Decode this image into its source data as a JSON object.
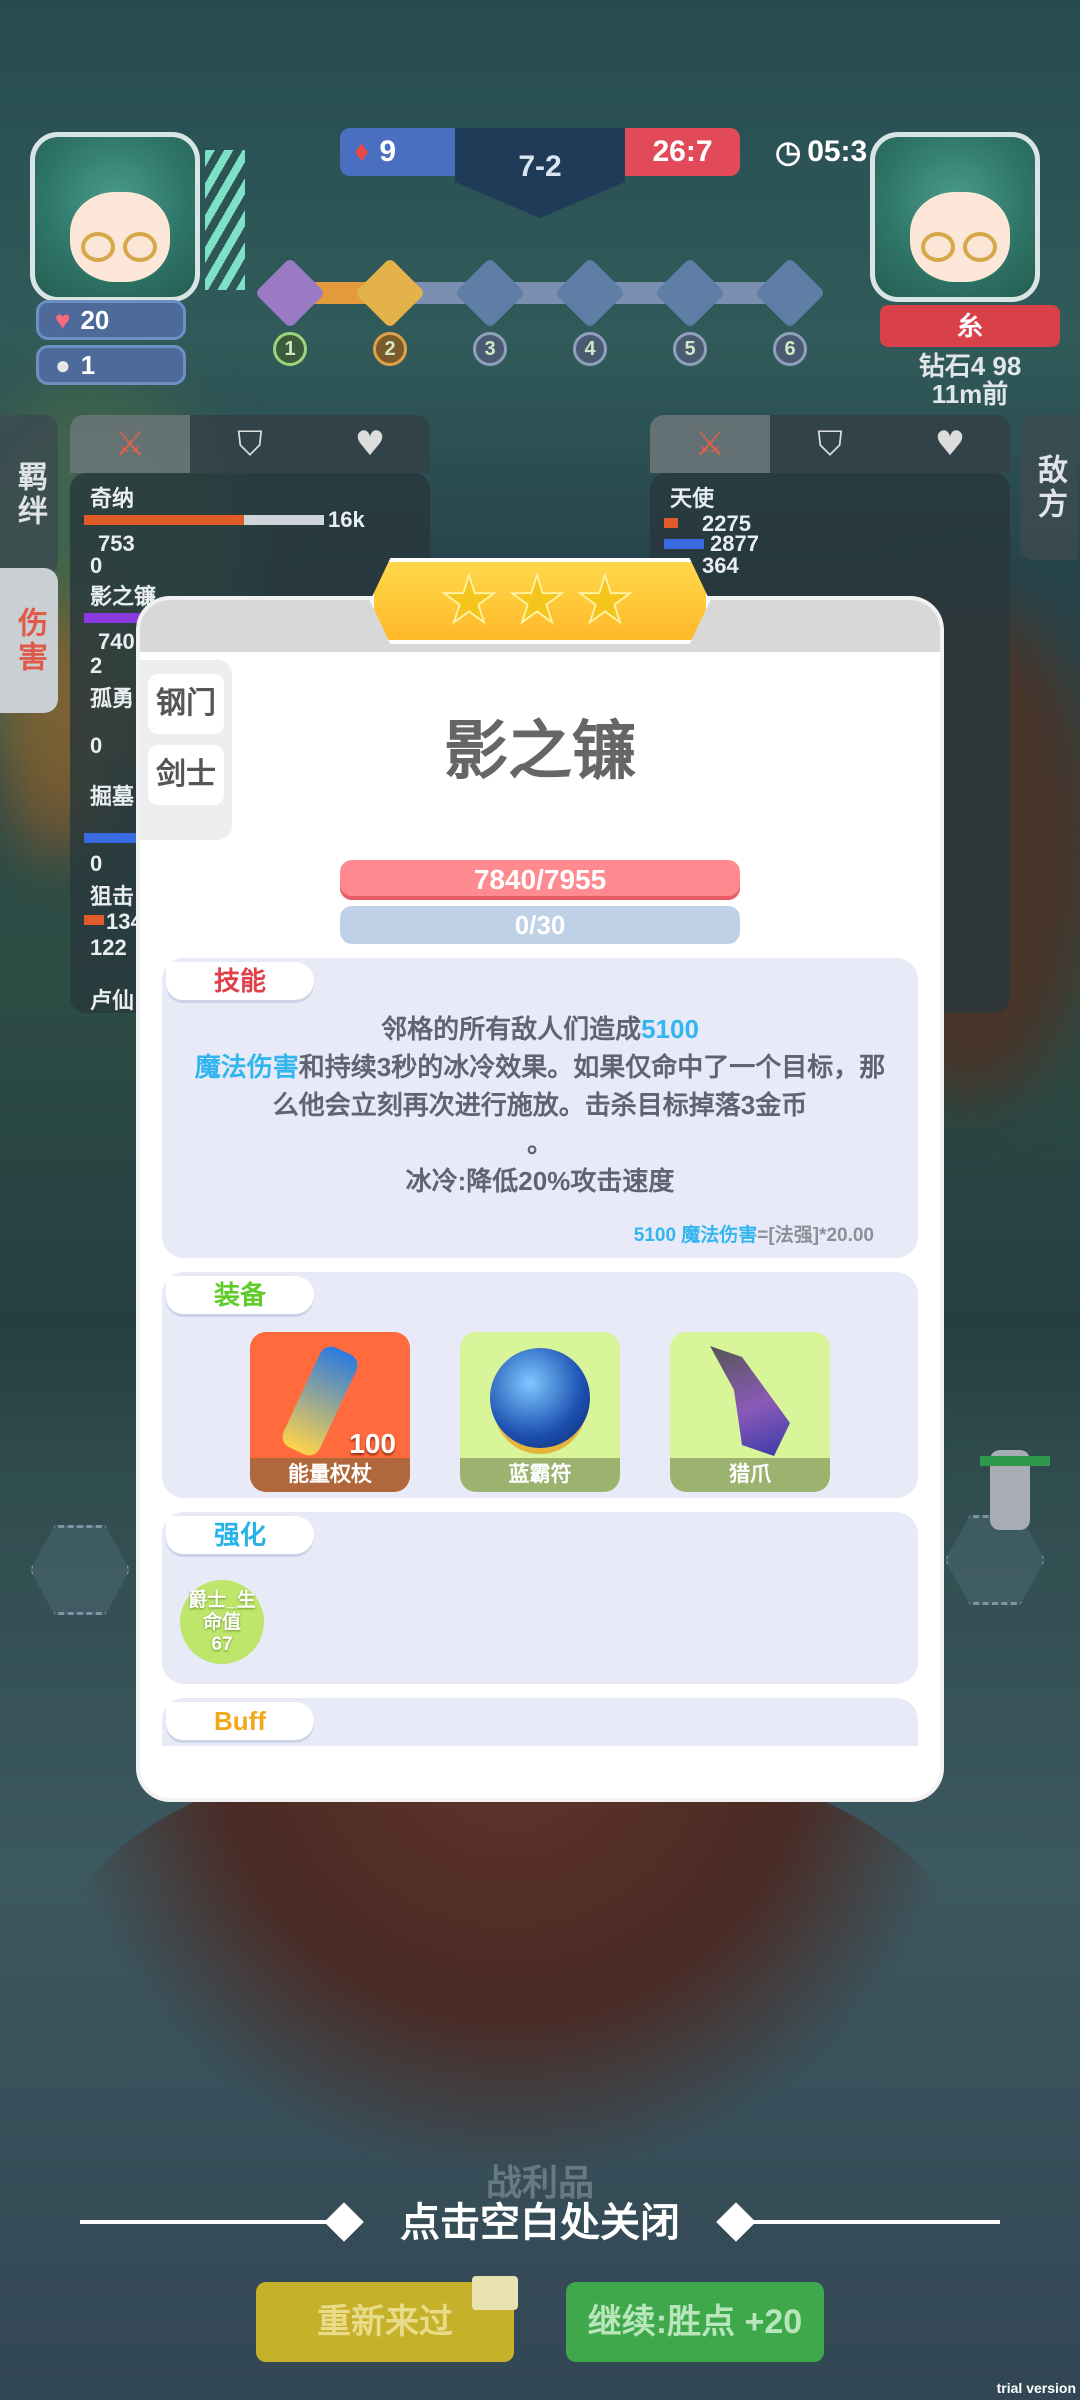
{
  "hud": {
    "left_hp": "20",
    "left_coins": "1",
    "score_left": "9",
    "stage": "7-2",
    "score_right": "26:7",
    "timer": "05:3",
    "rounds": [
      "1",
      "2",
      "3",
      "4",
      "5",
      "6"
    ],
    "right_player_label": "糸",
    "right_player_info_1": "钻石4 98",
    "right_player_info_2": "11m前"
  },
  "left_panel": {
    "side_tabs": [
      "羁绊",
      "伤害"
    ],
    "entries": [
      {
        "name": "奇纳",
        "value": "16k",
        "value2": "753",
        "value3": "0"
      },
      {
        "name": "影之镰",
        "value": "740",
        "value2": "2"
      },
      {
        "name": "孤勇",
        "value": "0"
      },
      {
        "name": "掘墓",
        "value": "0"
      },
      {
        "name": "狙击",
        "value": "122",
        "value2": "134"
      },
      {
        "name": "卢仙",
        "value": "0"
      }
    ]
  },
  "right_panel": {
    "side_tab": "敌方",
    "entries": [
      {
        "name": "天使",
        "value": "2275",
        "value2": "2877",
        "value3": "364"
      }
    ]
  },
  "modal": {
    "stars": 3,
    "traits": [
      "钢门",
      "剑士"
    ],
    "unit_name": "影之镰",
    "hp": "7840/7955",
    "mana": "0/30",
    "skill_label": "技能",
    "skill_line1_pre": "邻格的所有敌人们造成",
    "skill_dmg": "5100",
    "skill_dmg_type": "魔法伤害",
    "skill_line2_post": "和持续3秒的冰冷效果。如果仅命中了一个目标，那么他会立刻再次进行施放。击杀目标掉落3金币",
    "skill_line3": "。",
    "skill_line4": "冰冷:降低20%攻击速度",
    "formula_value": "5100 魔法伤害",
    "formula_expr": "=[法强]*20.00",
    "equip_label": "装备",
    "items": [
      {
        "name": "能量权杖",
        "badge": "100",
        "bg": "#ff6b3d"
      },
      {
        "name": "蓝霸符",
        "badge": "",
        "bg": "#d9f59a"
      },
      {
        "name": "猎爪",
        "badge": "",
        "bg": "#d9f59a"
      }
    ],
    "enhance_label": "强化",
    "enhance_bubble_line1": "爵士_生",
    "enhance_bubble_line2": "命值",
    "enhance_bubble_value": "67",
    "buff_label": "Buff"
  },
  "footer": {
    "loot_label": "战利品",
    "close_hint": "点击空白处关闭",
    "retry_button": "重新来过",
    "continue_button": "继续:胜点 +20",
    "trial": "trial version"
  },
  "colors": {
    "skill_label": "#e0404a",
    "equip_label": "#5fcc2a",
    "enhance_label": "#27b3e6",
    "buff_label": "#f2a81b",
    "retry_bg": "#c7b12a",
    "continue_bg": "#3fa84a"
  }
}
